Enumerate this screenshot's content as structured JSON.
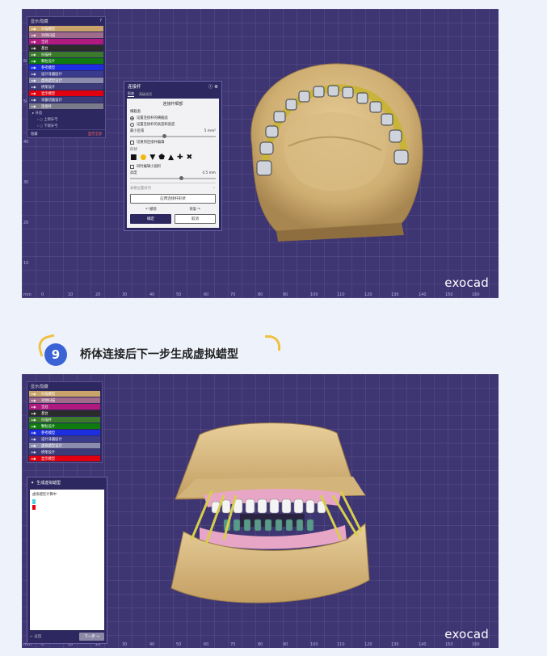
{
  "shot1": {
    "tree": {
      "header": "显示/隐藏",
      "help": "?",
      "items": [
        {
          "label": "扫描模型",
          "color": "#c9a36a"
        },
        {
          "label": "对颌扫描",
          "color": "#a06a8a"
        },
        {
          "label": "全冠",
          "color": "#b0197e"
        },
        {
          "label": "基台",
          "color": "#2b2b2b"
        },
        {
          "label": "扫描杆",
          "color": "#3a7a2a"
        },
        {
          "label": "颗粒设计",
          "color": "#0e7a10"
        },
        {
          "label": "参考模型",
          "color": "#1c2fe0"
        },
        {
          "label": "设计牙龈层计",
          "color": "#3b3b8e"
        },
        {
          "label": "虚拟蜡型设计",
          "color": "#8a8cae"
        },
        {
          "label": "桥架设计",
          "color": "#3b3b7a"
        },
        {
          "label": "显示模型",
          "color": "#e00010"
        },
        {
          "label": "牙龈切面设计",
          "color": "#3b3b7a"
        },
        {
          "label": "连接杆",
          "color": "#7a7a8a"
        }
      ],
      "sub_header": "牙齿",
      "sub_items": [
        "上颌牙弓",
        "下颌牙弓"
      ],
      "footer_left": "隐藏",
      "footer_right": "显示全部"
    },
    "dialog": {
      "title": "连接杆",
      "tabs": [
        "形态",
        "高级选项"
      ],
      "section": "连接杆细部",
      "group_label": "横截面",
      "radio1": "设置连接杆的横截面",
      "radio2": "设置连接杆的高度和宽度",
      "min_label": "最小区域",
      "min_value": "5 mm²",
      "check1": "切换到连接杆编辑",
      "shape_label": "形状",
      "check2": "同时编辑小面积",
      "height_label": "高度",
      "height_value": "4.5 mm",
      "collapse_label": "表格位置排列",
      "apply_btn": "应用连接杆形状",
      "undo": "撤销",
      "redo": "恢复",
      "ok": "确定",
      "cancel": "取消"
    },
    "x_ticks": [
      "mm",
      "0",
      "10",
      "20",
      "30",
      "40",
      "50",
      "60",
      "70",
      "80",
      "90",
      "100",
      "110",
      "120",
      "130",
      "140",
      "150",
      "160"
    ],
    "y_ticks": [
      "60",
      "50",
      "40",
      "30",
      "20",
      "10"
    ],
    "brand": "exocad"
  },
  "heading": {
    "number": "9",
    "text": "桥体连接后下一步生成虚拟蜡型"
  },
  "shot2": {
    "tree": {
      "header": "显示/隐藏",
      "items": [
        {
          "label": "扫描模型",
          "color": "#c9a36a"
        },
        {
          "label": "对颌扫描",
          "color": "#a06a8a"
        },
        {
          "label": "全冠",
          "color": "#b0197e"
        },
        {
          "label": "基台",
          "color": "#2b2b2b"
        },
        {
          "label": "扫描杆",
          "color": "#3a7a2a"
        },
        {
          "label": "颗粒设计",
          "color": "#0e7a10"
        },
        {
          "label": "参考模型",
          "color": "#1c2fe0"
        },
        {
          "label": "设计牙龈层计",
          "color": "#3b3b8e"
        },
        {
          "label": "虚拟蜡型设计",
          "color": "#8a8cae"
        },
        {
          "label": "桥架设计",
          "color": "#3b3b7a"
        },
        {
          "label": "显示模型",
          "color": "#e00010"
        }
      ]
    },
    "wax": {
      "title": "生成虚拟蜡型",
      "body_text": "虚拟蜡型计算中",
      "back": "返回",
      "next": "下一步"
    },
    "x_ticks": [
      "mm",
      "0",
      "10",
      "20",
      "30",
      "40",
      "50",
      "60",
      "70",
      "80",
      "90",
      "100",
      "110",
      "120",
      "130",
      "140",
      "150",
      "160"
    ],
    "brand": "exocad"
  }
}
